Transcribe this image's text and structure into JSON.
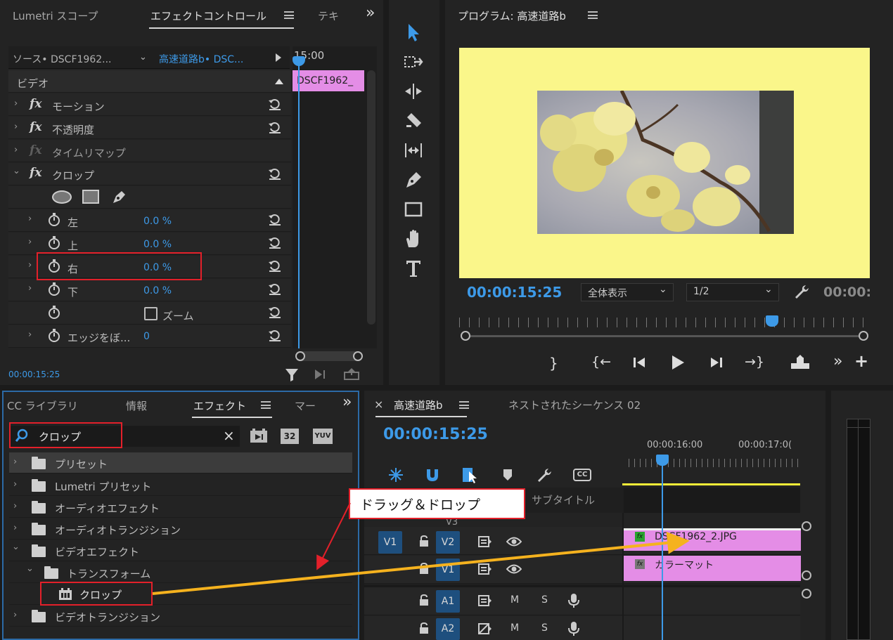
{
  "effect_controls": {
    "tabs": [
      "Lumetri スコープ",
      "エフェクトコントロール",
      "テキ"
    ],
    "overflow": "»",
    "source_label": "ソース• DSCF1962...",
    "sequence_label": "高速道路b• DSC...",
    "ruler_time": "15:00",
    "clip_name": "DSCF1962_",
    "section_video": "ビデオ",
    "effects": [
      {
        "label": "モーション"
      },
      {
        "label": "不透明度"
      },
      {
        "label": "タイムリマップ"
      },
      {
        "label": "クロップ"
      }
    ],
    "crop_params": [
      {
        "label": "左",
        "value": "0.0 %"
      },
      {
        "label": "上",
        "value": "0.0 %"
      },
      {
        "label": "右",
        "value": "0.0 %"
      },
      {
        "label": "下",
        "value": "0.0 %"
      }
    ],
    "zoom_label": "ズーム",
    "edge_label": "エッジをぼ...",
    "edge_value": "0",
    "timecode": "00:00:15:25"
  },
  "tools": [
    "selection",
    "track-select",
    "ripple",
    "razor",
    "slip",
    "pen",
    "rectangle",
    "hand",
    "type"
  ],
  "program_monitor": {
    "title": "プログラム: 高速道路b",
    "timecode": "00:00:15:25",
    "fit_label": "全体表示",
    "resolution_label": "1/2",
    "duration_partial": "00:00:",
    "frame_color": "#faf68a"
  },
  "effects_panel": {
    "tabs": [
      "CC ライブラリ",
      "情報",
      "エフェクト",
      "マー"
    ],
    "overflow": "»",
    "search_value": "クロップ",
    "clear": "×",
    "badge_32": "32",
    "badge_yuv": "YUV",
    "tree": [
      {
        "label": "プリセット",
        "depth": 0
      },
      {
        "label": "Lumetri プリセット",
        "depth": 0
      },
      {
        "label": "オーディオエフェクト",
        "depth": 0
      },
      {
        "label": "オーディオトランジション",
        "depth": 0
      },
      {
        "label": "ビデオエフェクト",
        "depth": 0
      },
      {
        "label": "トランスフォーム",
        "depth": 1
      },
      {
        "label": "クロップ",
        "depth": 2
      },
      {
        "label": "ビデオトランジション",
        "depth": 0
      }
    ]
  },
  "timeline": {
    "close": "×",
    "tab_active": "高速道路b",
    "tab_other": "ネストされたシーケンス 02",
    "timecode": "00:00:15:25",
    "ruler_labels": [
      "00:00:16:00",
      "00:00:17:0("
    ],
    "subtitle_label": "サブタイトル",
    "v3_label": "V3",
    "track_rows": [
      {
        "src": "V1",
        "dst": "V2"
      },
      {
        "src": "",
        "dst": "V1"
      },
      {
        "src": "",
        "dst": "A1"
      },
      {
        "src": "",
        "dst": "A2"
      }
    ],
    "m": "M",
    "s": "S",
    "clips": [
      {
        "name": "DSCF1962_2.JPG",
        "color": "#e48de6"
      },
      {
        "name": "カラーマット",
        "color": "#e48de6"
      }
    ],
    "cc_icon_label": "CC"
  },
  "annotation": {
    "callout": "ドラッグ＆ドロップ",
    "arrow_color": "#f5b21e",
    "box_color": "#e3202a"
  }
}
